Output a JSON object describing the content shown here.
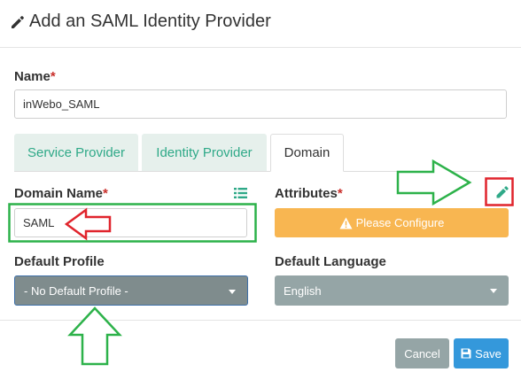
{
  "dialog": {
    "title": "Add an SAML Identity Provider",
    "title_icon": "pencil-icon"
  },
  "name_field": {
    "label": "Name",
    "required_mark": "*",
    "value": "inWebo_SAML"
  },
  "tabs": [
    {
      "label": "Service Provider",
      "active": false
    },
    {
      "label": "Identity Provider",
      "active": false
    },
    {
      "label": "Domain",
      "active": true
    }
  ],
  "domain_name": {
    "label": "Domain Name",
    "required_mark": "*",
    "value": "SAML",
    "icon": "list-icon"
  },
  "attributes": {
    "label": "Attributes",
    "required_mark": "*",
    "edit_icon": "pencil-icon",
    "button_label": "Please Configure",
    "button_icon": "warning-icon"
  },
  "default_profile": {
    "label": "Default Profile",
    "selected": "- No Default Profile -"
  },
  "default_language": {
    "label": "Default Language",
    "selected": "English"
  },
  "footer": {
    "cancel_label": "Cancel",
    "save_label": "Save",
    "save_icon": "floppy-disk-icon"
  },
  "colors": {
    "accent_green": "#2fa988",
    "tab_inactive_bg": "#e6f0ec",
    "warning_orange": "#f8b651",
    "select_gray": "#7f8c8d",
    "cancel_gray": "#95a5a6",
    "save_blue": "#3498db",
    "annotation_green": "#2db24a",
    "annotation_red": "#e0242c"
  }
}
